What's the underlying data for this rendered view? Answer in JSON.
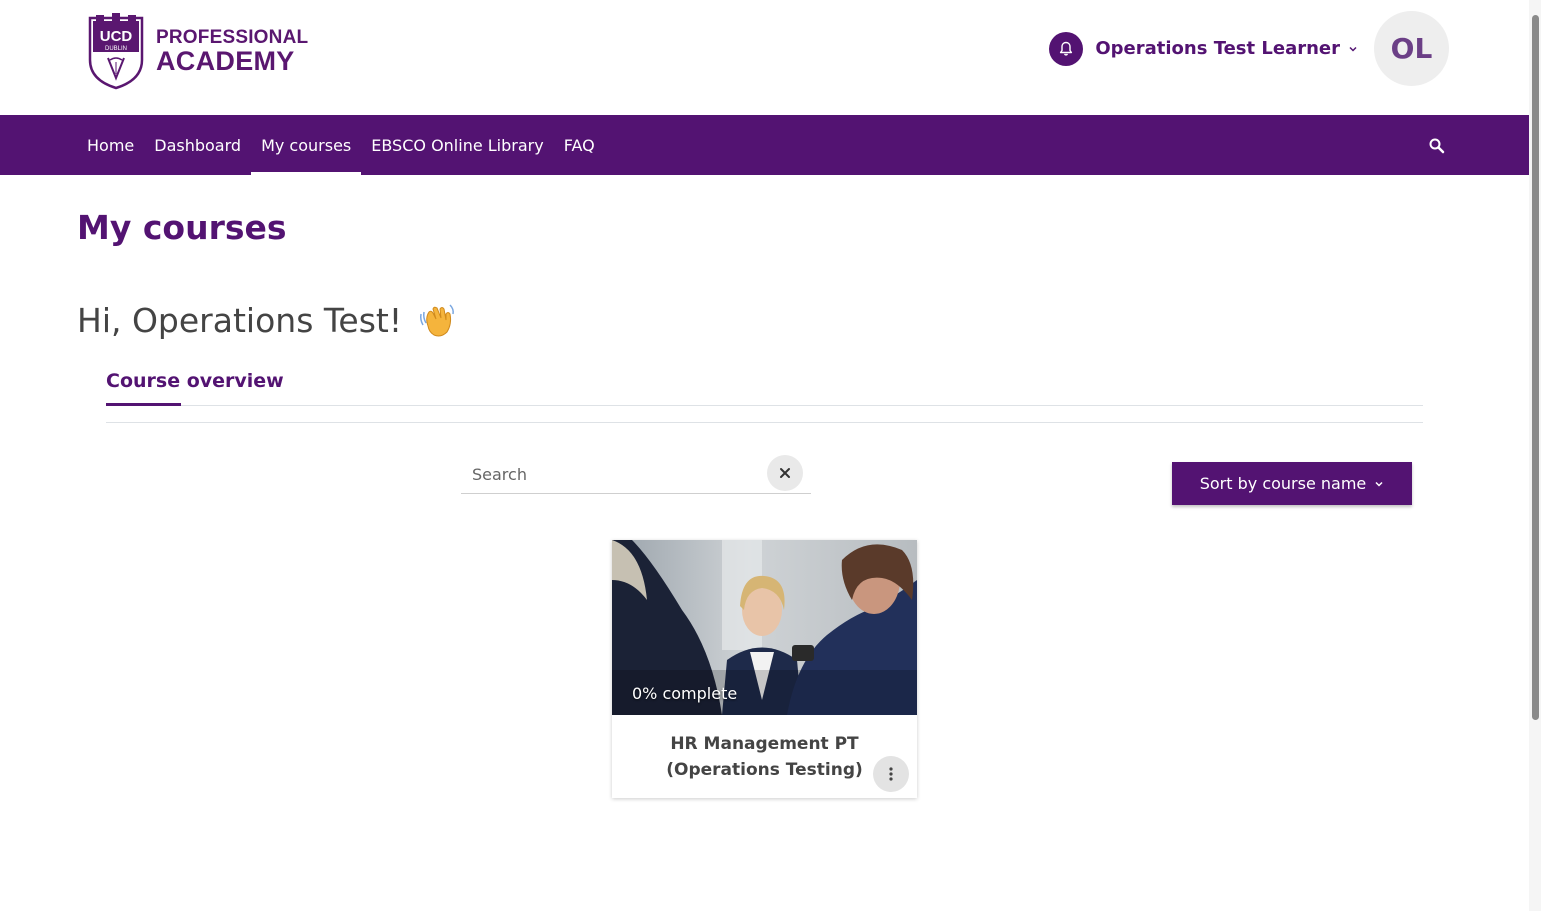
{
  "logo": {
    "line1": "PROFESSIONAL",
    "line2": "ACADEMY",
    "shield_text_top": "UCD",
    "shield_text_bottom": "DUBLIN"
  },
  "user": {
    "name": "Operations Test Learner",
    "initials": "OL",
    "bell_icon": "bell-icon"
  },
  "nav": {
    "items": [
      {
        "label": "Home",
        "active": false
      },
      {
        "label": "Dashboard",
        "active": false
      },
      {
        "label": "My courses",
        "active": true
      },
      {
        "label": "EBSCO Online Library",
        "active": false
      },
      {
        "label": "FAQ",
        "active": false
      }
    ],
    "search_icon": "search-icon"
  },
  "page": {
    "title": "My courses",
    "greeting": "Hi, Operations Test!",
    "greeting_emoji": "waving-hand-icon"
  },
  "tabs": [
    {
      "label": "Course overview",
      "active": true
    }
  ],
  "search": {
    "placeholder": "Search",
    "value": ""
  },
  "sort": {
    "label": "Sort by course name"
  },
  "courses": [
    {
      "title": "HR Management PT (Operations Testing)",
      "progress": "0% complete",
      "progress_value": 0
    }
  ],
  "colors": {
    "brand": "#531372",
    "brand_text": "#5a1770",
    "background": "#ffffff"
  }
}
